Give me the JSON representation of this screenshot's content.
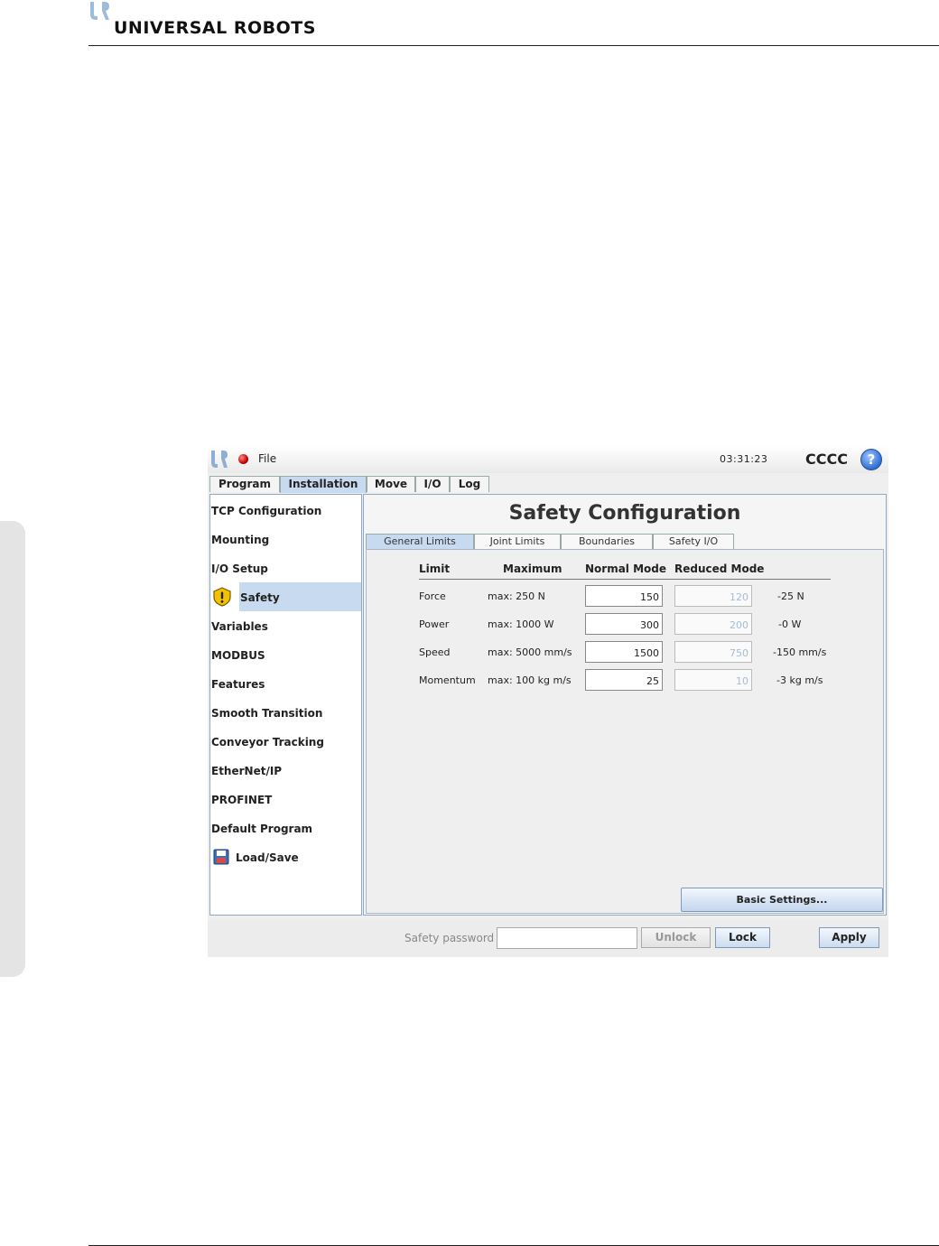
{
  "brand": {
    "name": "UNIVERSAL ROBOTS"
  },
  "app": {
    "file_menu": "File",
    "clock": "03:31:23",
    "robot_name": "CCCC",
    "help": "?",
    "main_tabs": [
      {
        "label": "Program",
        "active": false
      },
      {
        "label": "Installation",
        "active": true
      },
      {
        "label": "Move",
        "active": false
      },
      {
        "label": "I/O",
        "active": false
      },
      {
        "label": "Log",
        "active": false
      }
    ],
    "nav": [
      {
        "label": "TCP Configuration"
      },
      {
        "label": "Mounting"
      },
      {
        "label": "I/O Setup"
      },
      {
        "label": "Safety",
        "selected": true,
        "icon": "warning-icon"
      },
      {
        "label": "Variables"
      },
      {
        "label": "MODBUS"
      },
      {
        "label": "Features"
      },
      {
        "label": "Smooth Transition"
      },
      {
        "label": "Conveyor Tracking"
      },
      {
        "label": "EtherNet/IP"
      },
      {
        "label": "PROFINET"
      },
      {
        "label": "Default Program"
      },
      {
        "label": "Load/Save",
        "icon": "floppy-disk-icon"
      }
    ],
    "page_title": "Safety Configuration",
    "sub_tabs": [
      {
        "label": "General Limits",
        "active": true
      },
      {
        "label": "Joint Limits",
        "active": false
      },
      {
        "label": "Boundaries",
        "active": false
      },
      {
        "label": "Safety I/O",
        "active": false
      }
    ],
    "limits_table": {
      "headers": [
        "Limit",
        "Maximum",
        "Normal Mode",
        "Reduced Mode"
      ],
      "rows": [
        {
          "limit": "Force",
          "maximum": "max: 250 N",
          "normal": "150",
          "reduced": "120",
          "delta": "-25 N"
        },
        {
          "limit": "Power",
          "maximum": "max: 1000 W",
          "normal": "300",
          "reduced": "200",
          "delta": "-0 W"
        },
        {
          "limit": "Speed",
          "maximum": "max: 5000 mm/s",
          "normal": "1500",
          "reduced": "750",
          "delta": "-150 mm/s"
        },
        {
          "limit": "Momentum",
          "maximum": "max: 100 kg m/s",
          "normal": "25",
          "reduced": "10",
          "delta": "-3 kg m/s"
        }
      ]
    },
    "basic_settings_button": "Basic Settings...",
    "safety_password_label": "Safety password",
    "safety_password_value": "",
    "unlock_button": "Unlock",
    "lock_button": "Lock",
    "apply_button": "Apply"
  },
  "colors": {
    "selected": "#c7daf0",
    "status_red": "#c40000",
    "help_blue": "#2f6fd2",
    "disabled_text": "#a5bdd8"
  }
}
